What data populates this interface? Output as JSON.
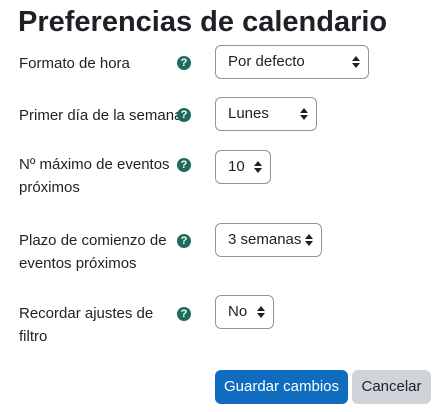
{
  "page": {
    "title": "Preferencias de calendario"
  },
  "fields": [
    {
      "label": "Formato de hora",
      "help": "?",
      "value": "Por defecto"
    },
    {
      "label": "Primer día de la semana",
      "help": "?",
      "value": "Lunes"
    },
    {
      "label": "Nº máximo de eventos próximos",
      "help": "?",
      "value": "10"
    },
    {
      "label": "Plazo de comienzo de eventos próximos",
      "help": "?",
      "value": "3 semanas"
    },
    {
      "label": "Recordar ajustes de filtro",
      "help": "?",
      "value": "No"
    }
  ],
  "actions": {
    "save_label": "Guardar cambios",
    "cancel_label": "Cancelar"
  },
  "colors": {
    "primary": "#0f6cbf",
    "secondary": "#ced4da",
    "help_icon": "#1f6b5c",
    "text": "#1d2125"
  },
  "icons": {
    "help": "question-circle-icon",
    "select": "sort-arrows-icon"
  }
}
